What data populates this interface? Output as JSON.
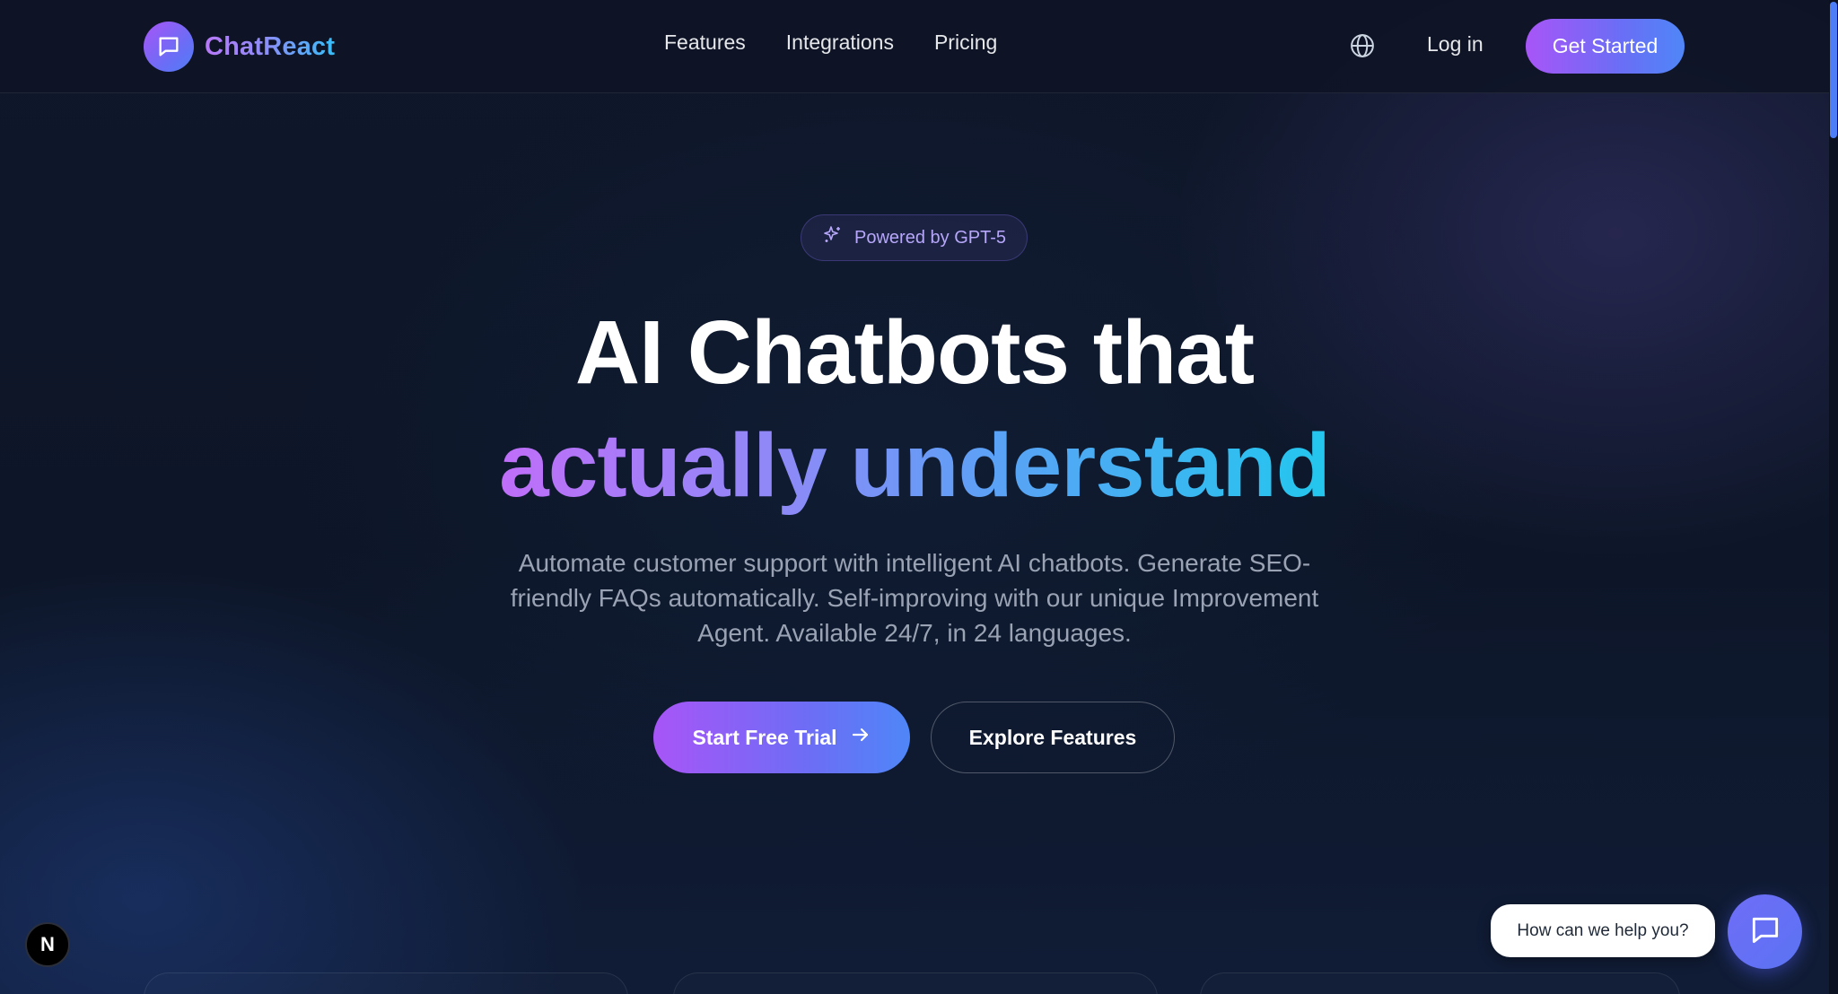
{
  "header": {
    "brand": "ChatReact",
    "nav": [
      {
        "label": "Features"
      },
      {
        "label": "Integrations"
      },
      {
        "label": "Pricing"
      }
    ],
    "language_icon": "globe-icon",
    "login_label": "Log in",
    "cta_label": "Get Started"
  },
  "hero": {
    "badge": "Powered by GPT-5",
    "headline_line1": "AI Chatbots that",
    "headline_line2": "actually understand",
    "subtitle": "Automate customer support with intelligent AI chatbots. Generate SEO-friendly FAQs automatically. Self-improving with our unique Improvement Agent. Available 24/7, in 24 languages.",
    "primary_cta": "Start Free Trial",
    "secondary_cta": "Explore Features"
  },
  "widgets": {
    "dev_badge": "N",
    "chat_prompt": "How can we help you?"
  },
  "colors": {
    "background": "#0f172a",
    "accent_purple": "#a855f7",
    "accent_blue": "#4f86f7",
    "accent_cyan": "#22c7ee"
  }
}
